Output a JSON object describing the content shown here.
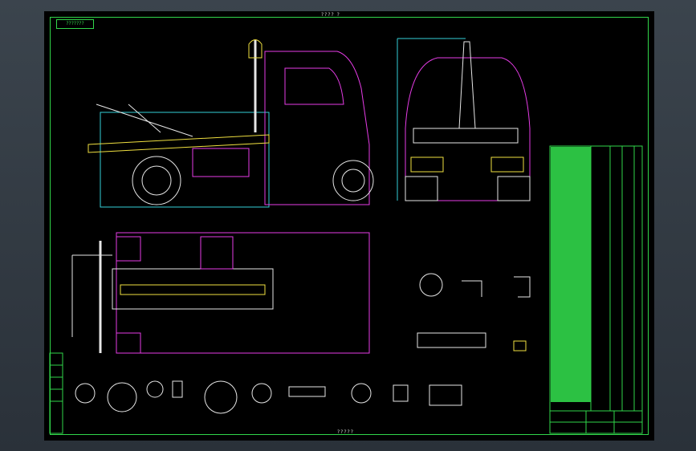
{
  "drawing": {
    "top_title": "???? ?",
    "bottom_title": "?????",
    "stamp": "???????",
    "notes_title": "??",
    "title_block_a": "????",
    "title_block_b": "????"
  },
  "colors": {
    "frame": "#31d64a",
    "background": "#000000",
    "magenta": "#e63ce6",
    "yellow": "#f0e040",
    "cyan": "#35d0d8",
    "white": "#e6e6e6",
    "green": "#31d64a",
    "red": "#e83a3a"
  },
  "icons": [
    "truck-side-view",
    "truck-rear-view",
    "chassis-plan-view",
    "detail-sections",
    "bill-of-materials"
  ]
}
